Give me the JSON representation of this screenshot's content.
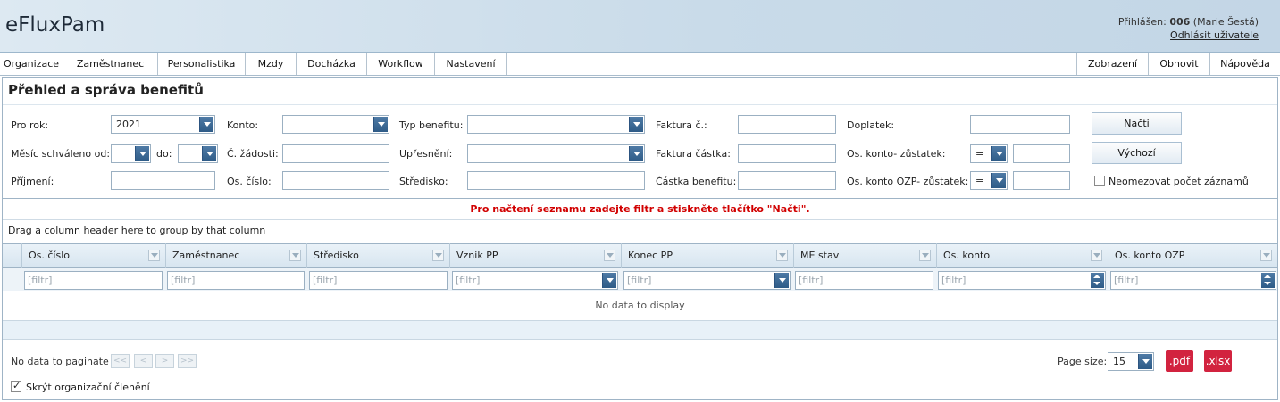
{
  "app": {
    "title": "eFluxPam"
  },
  "user": {
    "prefix": "Přihlášen:",
    "id": "006",
    "name": "(Marie Šestá)",
    "logout": "Odhlásit uživatele"
  },
  "menu": {
    "left": [
      "Organizace",
      "Zaměstnanec",
      "Personalistika",
      "Mzdy",
      "Docházka",
      "Workflow",
      "Nastavení"
    ],
    "right": [
      "Zobrazení",
      "Obnovit",
      "Nápověda"
    ]
  },
  "page": {
    "title": "Přehled a správa benefitů"
  },
  "form": {
    "pro_rok": {
      "label": "Pro rok:",
      "value": "2021"
    },
    "konto": {
      "label": "Konto:",
      "value": ""
    },
    "typ_benefitu": {
      "label": "Typ benefitu:",
      "value": ""
    },
    "faktura_c": {
      "label": "Faktura č.:",
      "value": ""
    },
    "doplatek": {
      "label": "Doplatek:",
      "value": ""
    },
    "mesic_od": {
      "label": "Měsíc schváleno od:",
      "value": ""
    },
    "mesic_do": {
      "label": "do:",
      "value": ""
    },
    "c_zadosti": {
      "label": "Č. žádosti:",
      "value": ""
    },
    "upresneni": {
      "label": "Upřesnění:",
      "value": ""
    },
    "faktura_castka": {
      "label": "Faktura částka:",
      "value": ""
    },
    "os_konto_zustatek": {
      "label": "Os. konto- zůstatek:",
      "op": "=",
      "value": ""
    },
    "prijmeni": {
      "label": "Příjmení:",
      "value": ""
    },
    "os_cislo": {
      "label": "Os. číslo:",
      "value": ""
    },
    "stredisko": {
      "label": "Středisko:",
      "value": ""
    },
    "castka_benefitu": {
      "label": "Částka benefitu:",
      "value": ""
    },
    "os_konto_ozp_zustatek": {
      "label": "Os. konto OZP- zůstatek:",
      "op": "=",
      "value": ""
    },
    "buttons": {
      "load": "Načti",
      "default": "Výchozí"
    },
    "unlimited": {
      "label": "Neomezovat počet záznamů",
      "checked": false
    }
  },
  "message": "Pro načtení seznamu zadejte filtr a stiskněte tlačítko \"Načti\".",
  "grid": {
    "group_hint": "Drag a column header here to group by that column",
    "columns": [
      "Os. číslo",
      "Zaměstnanec",
      "Středisko",
      "Vznik PP",
      "Konec PP",
      "ME stav",
      "Os. konto",
      "Os. konto OZP"
    ],
    "filter_placeholder": "[filtr]",
    "no_data": "No data to display"
  },
  "pager": {
    "text": "No data to paginate",
    "buttons": [
      "<<",
      "<",
      ">",
      ">>"
    ],
    "page_size_label": "Page size:",
    "page_size": "15",
    "export": [
      ".pdf",
      ".xlsx"
    ]
  },
  "footer": {
    "hide_org": {
      "label": "Skrýt organizační členění",
      "checked": true
    }
  },
  "colors": {
    "accent": "#2e5b87",
    "message": "#d10000",
    "export": "#d2233f"
  }
}
